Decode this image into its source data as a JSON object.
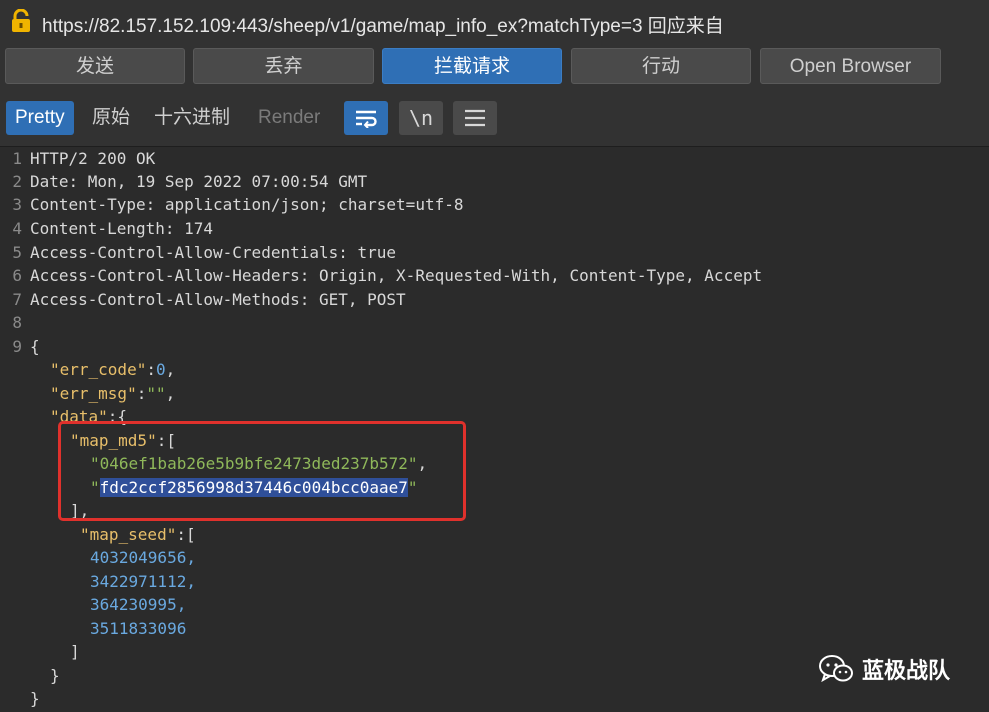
{
  "request": {
    "url": "https://82.157.152.109:443/sheep/v1/game/map_info_ex?matchType=3 回应来自"
  },
  "actions": [
    "发送",
    "丢弃",
    "拦截请求",
    "行动",
    "Open Browser"
  ],
  "view_tabs": [
    "Pretty",
    "原始",
    "十六进制",
    "Render"
  ],
  "toolbar_icons": [
    "wrap-lines-icon",
    "newline-icon",
    "menu-icon"
  ],
  "newline_symbol": "\\n",
  "response_lines": [
    {
      "n": "1",
      "text": "HTTP/2 200 OK"
    },
    {
      "n": "2",
      "text": "Date: Mon, 19 Sep 2022 07:00:54 GMT"
    },
    {
      "n": "3",
      "text": "Content-Type: application/json; charset=utf-8"
    },
    {
      "n": "4",
      "text": "Content-Length: 174"
    },
    {
      "n": "5",
      "text": "Access-Control-Allow-Credentials: true"
    },
    {
      "n": "6",
      "text": "Access-Control-Allow-Headers: Origin, X-Requested-With, Content-Type, Accept"
    },
    {
      "n": "7",
      "text": "Access-Control-Allow-Methods: GET, POST"
    },
    {
      "n": "8",
      "text": ""
    },
    {
      "n": "9",
      "text": "{"
    }
  ],
  "json_body": {
    "err_code_key": "\"err_code\"",
    "err_code_val": "0",
    "err_msg_key": "\"err_msg\"",
    "err_msg_val": "\"\"",
    "data_key": "\"data\"",
    "map_md5_key": "\"map_md5\"",
    "md5_1": "\"046ef1bab26e5b9bfe2473ded237b572\"",
    "md5_2_quote": "\"",
    "md5_2": "fdc2ccf2856998d37446c004bcc0aae7",
    "md5_2_end": "\"",
    "map_seed_key": "\"map_seed\"",
    "seeds": [
      "4032049656,",
      "3422971112,",
      "364230995,",
      "3511833096"
    ]
  },
  "watermark": "蓝极战队",
  "colors": {
    "accent": "#2f6fb5",
    "highlight_box": "#e0312c",
    "json_key": "#e8bf6a",
    "json_string": "#8fb85a",
    "json_number": "#6aa9e0"
  }
}
